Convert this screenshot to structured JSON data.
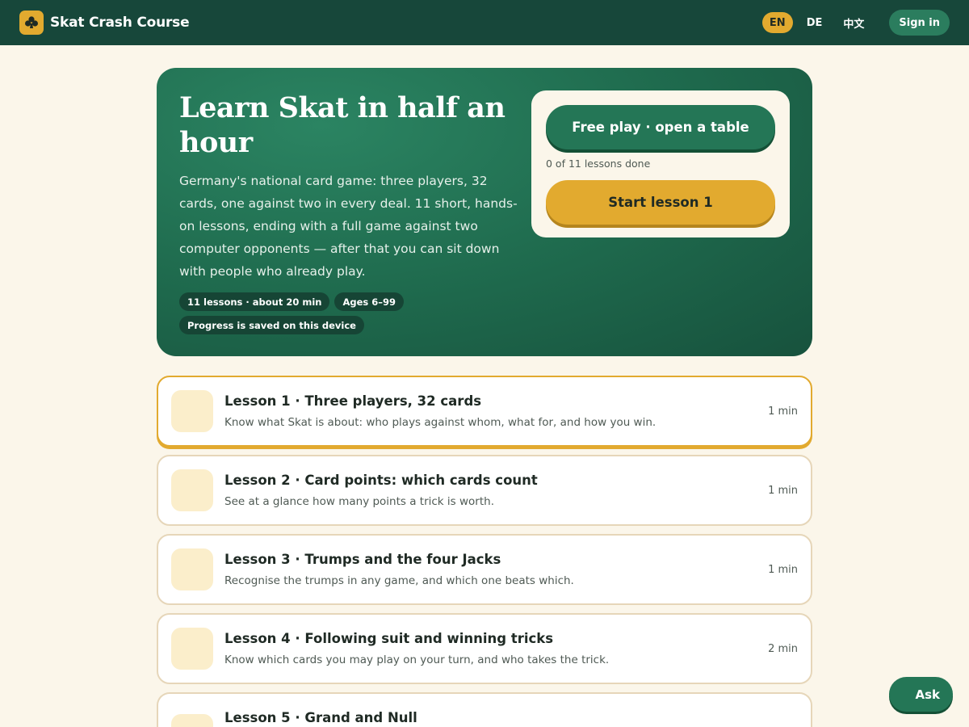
{
  "header": {
    "brand_title": "Skat Crash Course",
    "brand_icon": "club-suit-icon",
    "languages": [
      {
        "code": "EN",
        "active": true
      },
      {
        "code": "DE",
        "active": false
      },
      {
        "code": "中文",
        "active": false
      }
    ],
    "signin_label": "Sign in"
  },
  "hero": {
    "title": "Learn Skat in half an hour",
    "description": "Germany's national card game: three players, 32 cards, one against two in every deal. 11 short, hands-on lessons, ending with a full game against two computer opponents — after that you can sit down with people who already play.",
    "chips": [
      "11 lessons · about 20 min",
      "Ages 6–99",
      "Progress is saved on this device"
    ],
    "free_play_label": "Free play · open a table",
    "progress_text": "0 of 11 lessons done",
    "start_label": "Start lesson 1"
  },
  "lessons": [
    {
      "title": "Lesson 1 · Three players, 32 cards",
      "description": "Know what Skat is about: who plays against whom, what for, and how you win.",
      "duration": "1 min"
    },
    {
      "title": "Lesson 2 · Card points: which cards count",
      "description": "See at a glance how many points a trick is worth.",
      "duration": "1 min"
    },
    {
      "title": "Lesson 3 · Trumps and the four Jacks",
      "description": "Recognise the trumps in any game, and which one beats which.",
      "duration": "1 min"
    },
    {
      "title": "Lesson 4 · Following suit and winning tricks",
      "description": "Know which cards you may play on your turn, and who takes the trick.",
      "duration": "2 min"
    },
    {
      "title": "Lesson 5 · Grand and Null",
      "description": "",
      "duration": ""
    }
  ],
  "ask_label": "Ask",
  "colors": {
    "header_bg": "#17473a",
    "accent_gold": "#e2aa2f",
    "green": "#247656",
    "page_bg": "#fbf6ea"
  }
}
